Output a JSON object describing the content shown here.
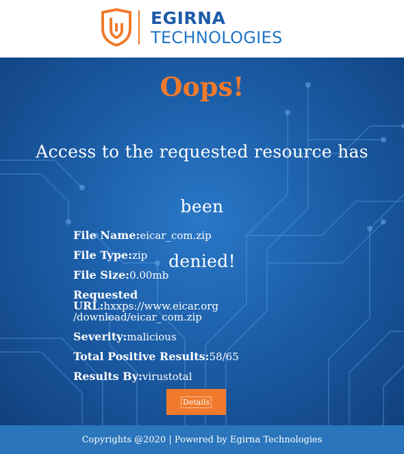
{
  "header": {
    "logo_top": "EGIRNA",
    "logo_bottom": "TECHNOLOGIES"
  },
  "main": {
    "title": "Oops!",
    "message_line1": "Access to the requested resource has been",
    "message_line2": "denied!",
    "details": [
      {
        "label": "File Name:",
        "value": "eicar_com.zip"
      },
      {
        "label": "File Type:",
        "value": "zip"
      },
      {
        "label": "File Size:",
        "value": "0.00mb"
      },
      {
        "label": "Requested URL:",
        "value": "hxxps://www.eicar.org /download/eicar_com.zip"
      },
      {
        "label": "Severity:",
        "value": "malicious"
      },
      {
        "label": "Total Positive Results:",
        "value": "58/65"
      },
      {
        "label": "Results By:",
        "value": "virustotal"
      }
    ],
    "details_button": "Details"
  },
  "footer": {
    "text": "Copyrights @2020 | Powered by Egirna Technologies"
  },
  "colors": {
    "accent": "#f07a2c",
    "brand_blue": "#1e5aa8",
    "footer_bg": "#2a75bb"
  }
}
